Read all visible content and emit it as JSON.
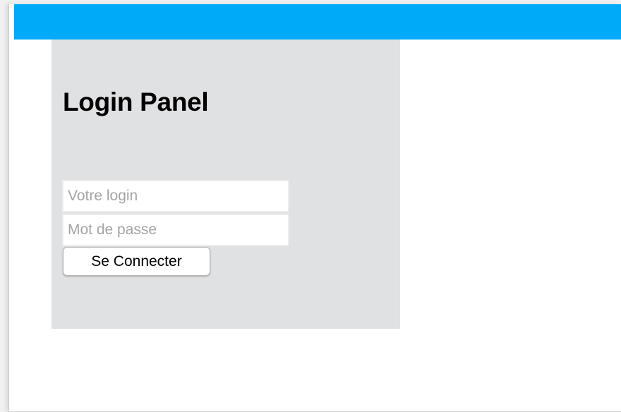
{
  "colors": {
    "header_bar": "#00aaf9",
    "panel_background": "#e0e1e3",
    "page_background": "#ffffff"
  },
  "login_panel": {
    "title": "Login Panel",
    "login_field": {
      "placeholder": "Votre login",
      "value": ""
    },
    "password_field": {
      "placeholder": "Mot de passe",
      "value": ""
    },
    "submit_label": "Se Connecter"
  }
}
